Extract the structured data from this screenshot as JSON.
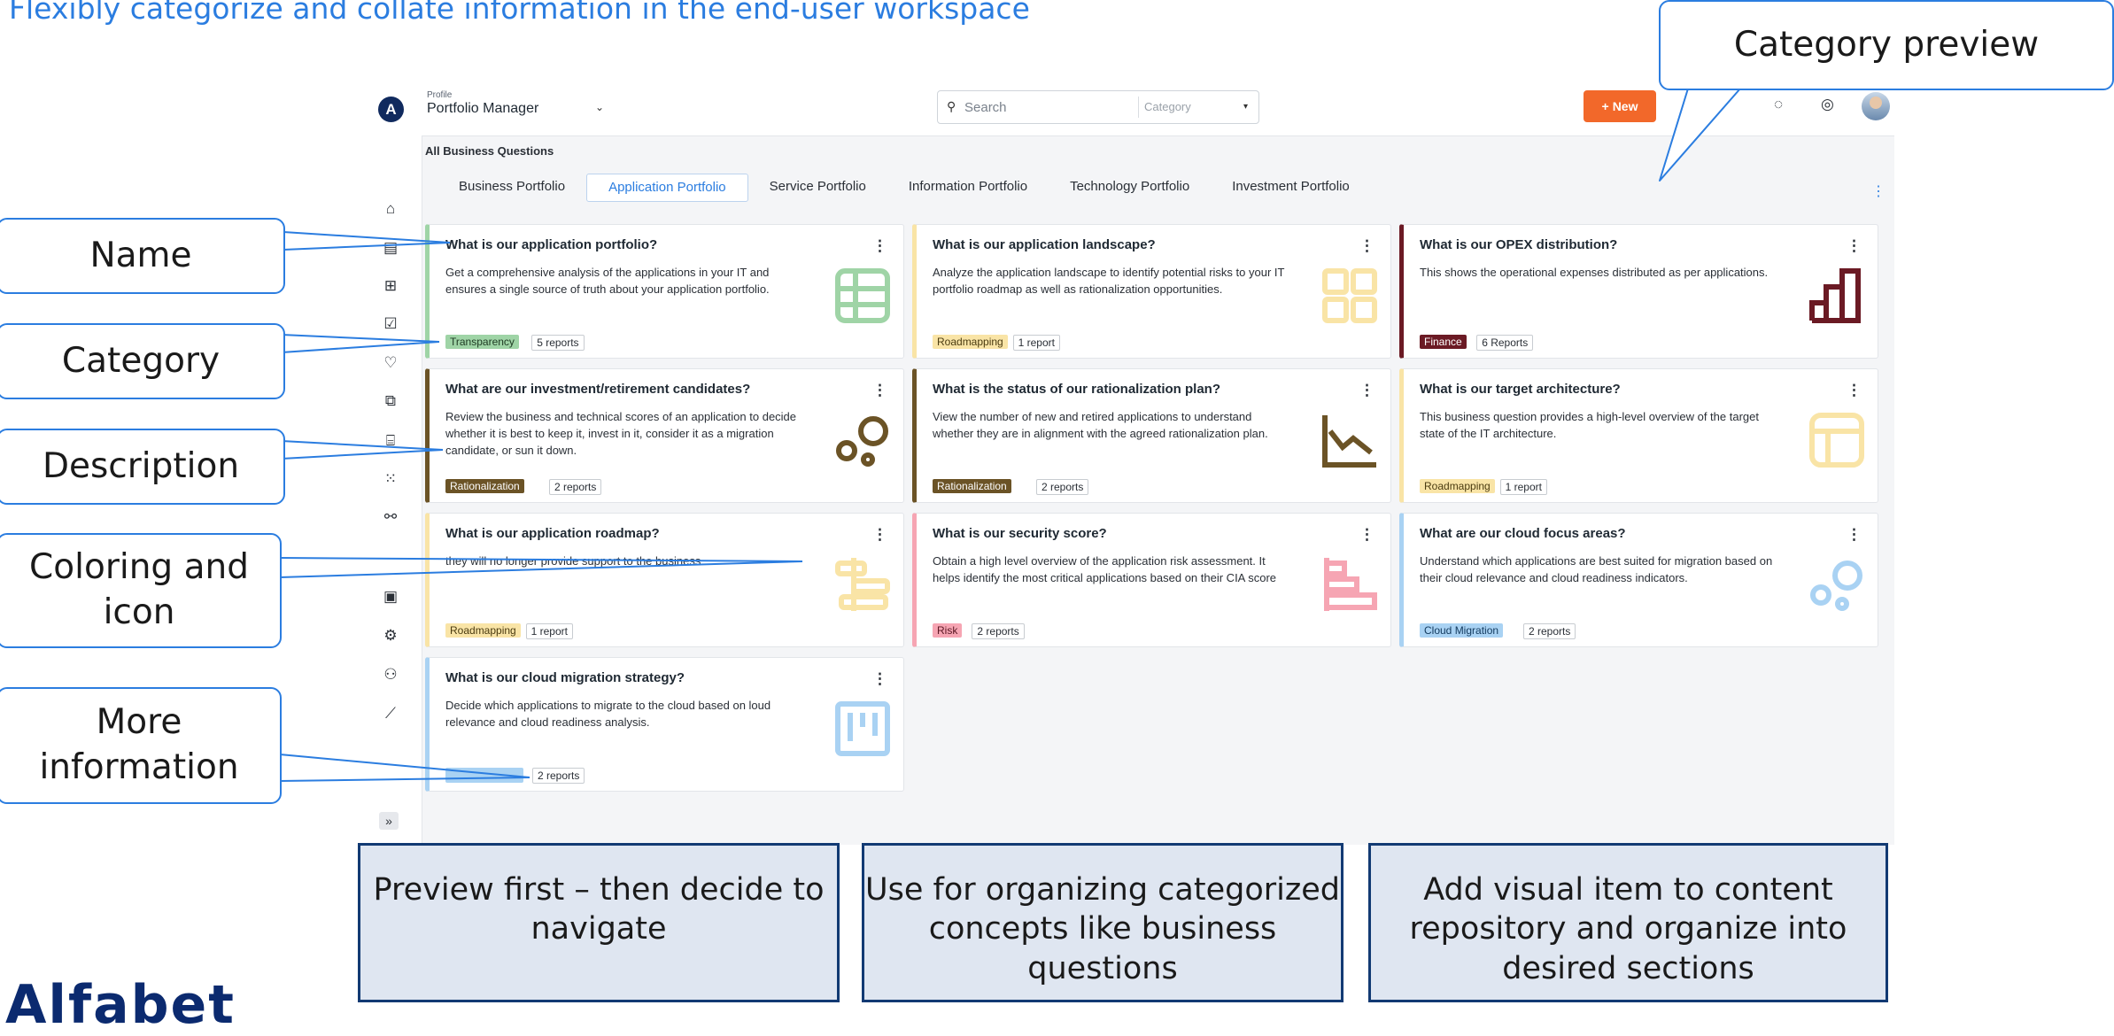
{
  "heading": "Flexibly categorize and collate information in the end-user workspace",
  "brand": "Alfabet",
  "app": {
    "logo": "A",
    "profile_label": "Profile",
    "profile_value": "Portfolio Manager",
    "search_placeholder": "Search",
    "category_placeholder": "Category",
    "new_label": "New",
    "breadcrumb": "All Business Questions",
    "sidebar_icons": [
      "home-icon",
      "document-icon",
      "diagram-icon",
      "checklist-icon",
      "heart-icon",
      "dashboard-icon",
      "building-icon",
      "grid-icon",
      "handshake-icon",
      "terminal-icon",
      "network-icon",
      "people-icon",
      "chart-icon"
    ],
    "expand_label": "»",
    "tabs": [
      {
        "label": "Business Portfolio"
      },
      {
        "label": "Application Portfolio"
      },
      {
        "label": "Service Portfolio"
      },
      {
        "label": "Information Portfolio"
      },
      {
        "label": "Technology Portfolio"
      },
      {
        "label": "Investment Portfolio"
      }
    ],
    "active_tab": "Application Portfolio",
    "cards": [
      {
        "title": "What is our application portfolio?",
        "description": "Get a comprehensive analysis of the applications in your IT and ensures a single source of truth about your application portfolio.",
        "category": "Transparency",
        "reports": "5 reports",
        "color": "#9fd4a6",
        "badge_text_color": "#1f3b24",
        "icon": "table-icon"
      },
      {
        "title": "What is our application landscape?",
        "description": "Analyze the application landscape to identify potential risks to your IT portfolio roadmap as well as rationalization opportunities.",
        "category": "Roadmapping",
        "reports": "1 report",
        "color": "#f9e4a6",
        "badge_text_color": "#4a3b10",
        "icon": "grid-icon"
      },
      {
        "title": "What is our OPEX distribution?",
        "description": "This shows the operational expenses distributed as per applications.",
        "category": "Finance",
        "reports": "6 Reports",
        "color": "#6b1a24",
        "badge_text_color": "#ffffff",
        "icon": "bar-chart-icon"
      },
      {
        "title": "What are our investment/retirement candidates?",
        "description": "Review the business and technical scores of an application to decide whether it is best to keep it, invest in it, consider it as a migration candidate, or sun it down.",
        "category": "Rationalization",
        "reports": "2 reports",
        "color": "#6b5326",
        "badge_text_color": "#ffffff",
        "icon": "bubbles-icon"
      },
      {
        "title": "What is the status of our rationalization plan?",
        "description": "View the number of new and retired applications to understand whether they are in alignment with the agreed rationalization plan.",
        "category": "Rationalization",
        "reports": "2 reports",
        "color": "#6b5326",
        "badge_text_color": "#ffffff",
        "icon": "line-chart-icon"
      },
      {
        "title": "What is our target architecture?",
        "description": "This business question provides a high-level overview of the target state of the IT architecture.",
        "category": "Roadmapping",
        "reports": "1 report",
        "color": "#f9e4a6",
        "badge_text_color": "#4a3b10",
        "icon": "layout-icon"
      },
      {
        "title": "What is our application roadmap?",
        "description": "they will no longer provide support to the business.",
        "category": "Roadmapping",
        "reports": "1 report",
        "color": "#f9e4a6",
        "badge_text_color": "#4a3b10",
        "icon": "roadmap-icon"
      },
      {
        "title": "What is our security score?",
        "description": "Obtain a high level overview of the application risk assessment. It helps identify the most critical applications based on their CIA score",
        "category": "Risk",
        "reports": "2 reports",
        "color": "#f6a5b3",
        "badge_text_color": "#5a1622",
        "icon": "horizontal-bar-icon"
      },
      {
        "title": "What are our cloud focus areas?",
        "description": "Understand which applications are best suited for migration based on their cloud relevance and cloud readiness indicators.",
        "category": "Cloud Migration",
        "reports": "2 reports",
        "color": "#a9d2f3",
        "badge_text_color": "#123a5e",
        "icon": "bubbles-icon"
      },
      {
        "title": "What is our cloud migration strategy?",
        "description": "Decide which applications to migrate to the cloud based on loud relevance and cloud readiness analysis.",
        "category": "",
        "reports": "2 reports",
        "color": "#a9d2f3",
        "badge_text_color": "#123a5e",
        "icon": "kanban-icon"
      }
    ]
  },
  "callouts": {
    "category_preview": "Category preview",
    "name": "Name",
    "category": "Category",
    "description": "Description",
    "coloring": "Coloring and icon",
    "more_info": "More information"
  },
  "info_boxes": [
    "Preview first – then decide to navigate",
    "Use for organizing categorized concepts like business questions",
    "Add visual item to content repository and organize into desired sections"
  ]
}
